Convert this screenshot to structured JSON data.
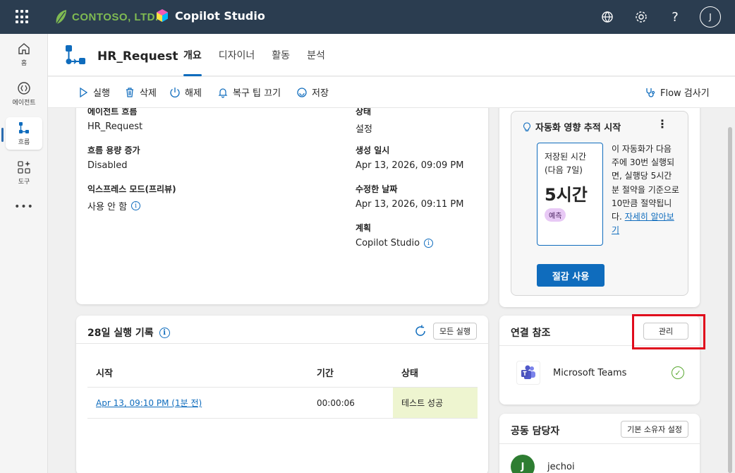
{
  "topbar": {
    "brand": "CONTOSO, LTD.",
    "product": "Copilot Studio",
    "avatar_initial": "J",
    "help_label": "?"
  },
  "rail": {
    "items": [
      {
        "label": "홈",
        "icon": "home-icon"
      },
      {
        "label": "에이전트",
        "icon": "agents-icon"
      },
      {
        "label": "흐름",
        "icon": "flow-icon"
      },
      {
        "label": "도구",
        "icon": "tools-icon"
      }
    ],
    "more": "•••"
  },
  "header": {
    "flow_name": "HR_Request",
    "tabs": [
      "개요",
      "디자이너",
      "활동",
      "분석"
    ],
    "active_tab": "개요"
  },
  "toolbar": {
    "run": "실행",
    "delete": "삭제",
    "turn_off": "해제",
    "recovery_tip": "복구 팁 끄기",
    "save": "저장",
    "flow_checker": "Flow 검사기"
  },
  "details": {
    "agent_flow_label": "에이전트 흐름",
    "agent_flow_value": "HR_Request",
    "capacity_label": "흐름 용량 증가",
    "capacity_value": "Disabled",
    "express_label": "익스프레스 모드(프리뷰)",
    "express_value": "사용 안 함",
    "status_label": "상태",
    "status_value": "설정",
    "created_label": "생성 일시",
    "created_value": "Apr 13, 2026, 09:09 PM",
    "modified_label": "수정한 날짜",
    "modified_value": "Apr 13, 2026, 09:11 PM",
    "plan_label": "계획",
    "plan_value": "Copilot Studio"
  },
  "runs": {
    "title": "28일 실행 기록",
    "all_runs": "모든 실행",
    "columns": [
      "시작",
      "기간",
      "상태"
    ],
    "rows": [
      {
        "start": "Apr 13, 09:10 PM (1분 전)",
        "duration": "00:00:06",
        "status": "테스트 성공"
      }
    ]
  },
  "impact": {
    "title": "자동화 영향 추적 시작",
    "more": "⋮",
    "saved_label": "저장된 시간(다음 7일)",
    "saved_value": "5시간",
    "badge": "예측",
    "desc": "이 자동화가 다음 주에 30번 실행되면, 실행당 5시간분 절약을 기준으로 10만큼 절약됩니다.",
    "learn_more": "자세히 알아보기",
    "cta": "절감 사용"
  },
  "connections": {
    "title": "연결 참조",
    "manage": "관리",
    "items": [
      {
        "name": "Microsoft Teams"
      }
    ]
  },
  "owners": {
    "title": "공동 담당자",
    "set_owner": "기본 소유자 설정",
    "people": [
      {
        "initial": "J",
        "name": "jechoi"
      }
    ]
  },
  "colors": {
    "topbar": "#2b3d50",
    "accent": "#0f6cbd",
    "highlight": "#e00b1c",
    "success_bg": "#eef5d0"
  }
}
